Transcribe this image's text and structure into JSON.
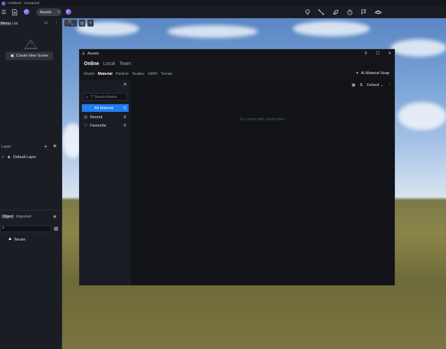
{
  "window": {
    "title": "Untitled - Unsaved"
  },
  "toolbar": {
    "menu_icon": "hamburger-icon",
    "assets_label": "Assets",
    "right_icons": [
      "lightbulb-icon",
      "line-tool-icon",
      "leaf-icon",
      "timer-icon",
      "flag-icon",
      "planet-icon"
    ]
  },
  "leftpanel": {
    "tabs": [
      "Menu",
      "List"
    ],
    "create_scene_label": "Create New Scene",
    "layer_header": "Layer",
    "layers": [
      {
        "name": "Default Layer"
      }
    ],
    "object_tabs": [
      "Object",
      "Imported"
    ],
    "objects": [
      {
        "name": "Terrain"
      }
    ]
  },
  "assets": {
    "title": "Assets",
    "source_tabs": [
      "Online",
      "Local",
      "Team"
    ],
    "active_source": "Online",
    "category_tabs": [
      "Model",
      "Material",
      "Particle",
      "Scatter",
      "HDRI",
      "Terrain"
    ],
    "active_category": "Material",
    "ai_snap_label": "AI Material Snap",
    "search_placeholder": "\"/\" Search Assets",
    "nav": [
      {
        "label": "All Material",
        "count": "0"
      },
      {
        "label": "Recent",
        "count": "0"
      },
      {
        "label": "Favourite",
        "count": "0"
      }
    ],
    "sort_label": "Default",
    "empty_text": "No content with current filters"
  },
  "colors": {
    "accent": "#1d7ef1",
    "orb": "#7b56e8",
    "panel": "#1b1d24"
  }
}
